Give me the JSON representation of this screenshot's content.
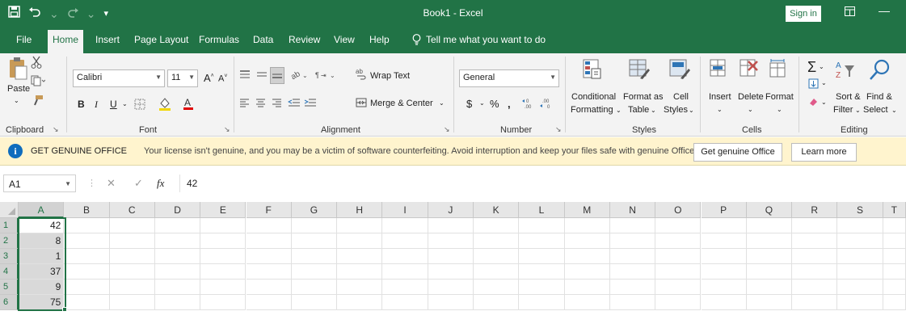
{
  "titlebar": {
    "save_icon": "save-icon",
    "undo_icon": "undo-icon",
    "redo_icon": "redo-icon",
    "customize_icon": "customize-qat-icon",
    "title": "Book1 - Excel",
    "sign_in": "Sign in",
    "ribbon_display_icon": "ribbon-display-options-icon",
    "minimize_icon": "minimize-icon"
  },
  "tabs": [
    "File",
    "Home",
    "Insert",
    "Page Layout",
    "Formulas",
    "Data",
    "Review",
    "View",
    "Help"
  ],
  "active_tab": "Home",
  "tell_me": "Tell me what you want to do",
  "ribbon": {
    "clipboard": {
      "label": "Clipboard",
      "paste": "Paste"
    },
    "font": {
      "label": "Font",
      "font_name": "Calibri",
      "font_size": "11",
      "bold": "B",
      "italic": "I",
      "underline": "U"
    },
    "alignment": {
      "label": "Alignment",
      "wrap_text": "Wrap Text",
      "merge_center": "Merge & Center"
    },
    "number": {
      "label": "Number",
      "format": "General",
      "currency": "$",
      "percent": "%",
      "comma": ","
    },
    "styles": {
      "label": "Styles",
      "conditional_1": "Conditional",
      "conditional_2": "Formatting",
      "format_table_1": "Format as",
      "format_table_2": "Table",
      "cell_styles_1": "Cell",
      "cell_styles_2": "Styles"
    },
    "cells": {
      "label": "Cells",
      "insert": "Insert",
      "delete": "Delete",
      "format": "Format"
    },
    "editing": {
      "label": "Editing",
      "sort_1": "Sort &",
      "sort_2": "Filter",
      "find_1": "Find &",
      "find_2": "Select"
    }
  },
  "warning": {
    "title": "GET GENUINE OFFICE",
    "message": "Your license isn't genuine, and you may be a victim of software counterfeiting. Avoid interruption and keep your files safe with genuine Office today.",
    "button_genuine": "Get genuine Office",
    "button_learn": "Learn more"
  },
  "formula_bar": {
    "name_box": "A1",
    "formula": "42",
    "fx": "fx"
  },
  "grid": {
    "columns": [
      "A",
      "B",
      "C",
      "D",
      "E",
      "F",
      "G",
      "H",
      "I",
      "J",
      "K",
      "L",
      "M",
      "N",
      "O",
      "P",
      "Q",
      "R",
      "S",
      "T"
    ],
    "rows": [
      "1",
      "2",
      "3",
      "4",
      "5",
      "6"
    ],
    "values_col_a": [
      "42",
      "8",
      "1",
      "37",
      "9",
      "75"
    ]
  },
  "colors": {
    "accent": "#217346",
    "warning_bg": "#fff4ce"
  }
}
